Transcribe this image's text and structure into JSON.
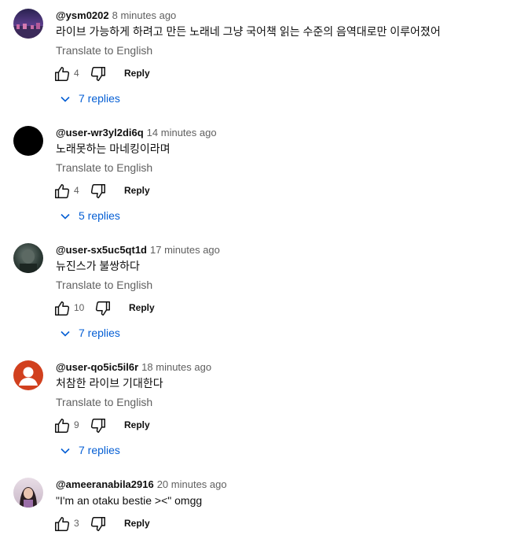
{
  "comments": [
    {
      "author": "@ysm0202",
      "time": "8 minutes ago",
      "text": "라이브 가능하게 하려고 만든 노래네 그냥 국어책 읽는 수준의 음역대로만 이루어졌어",
      "translate": "Translate to English",
      "likes": "4",
      "reply": "Reply",
      "replies": "7 replies",
      "avatar_color": "#4a3a7a"
    },
    {
      "author": "@user-wr3yl2di6q",
      "time": "14 minutes ago",
      "text": "노래못하는 마네킹이라며",
      "translate": "Translate to English",
      "likes": "4",
      "reply": "Reply",
      "replies": "5 replies",
      "avatar_color": "#000000"
    },
    {
      "author": "@user-sx5uc5qt1d",
      "time": "17 minutes ago",
      "text": "뉴진스가 불쌍하다",
      "translate": "Translate to English",
      "likes": "10",
      "reply": "Reply",
      "replies": "7 replies",
      "avatar_color": "#2b3a35"
    },
    {
      "author": "@user-qo5ic5il6r",
      "time": "18 minutes ago",
      "text": "처참한 라이브 기대한다",
      "translate": "Translate to English",
      "likes": "9",
      "reply": "Reply",
      "replies": "7 replies",
      "avatar_color": "#d1401e"
    },
    {
      "author": "@ameeranabila2916",
      "time": "20 minutes ago",
      "text": "\"I'm an otaku bestie ><\" omgg",
      "likes": "3",
      "reply": "Reply",
      "avatar_color": "#c9b8c8"
    }
  ],
  "colors": {
    "link_blue": "#065fd4",
    "secondary_text": "#606060"
  }
}
